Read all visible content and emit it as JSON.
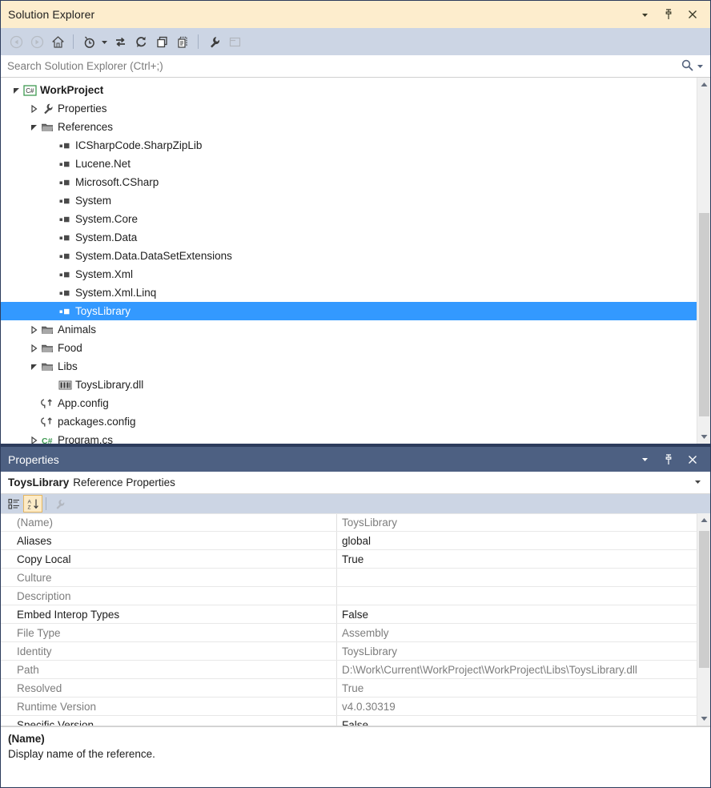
{
  "solution_explorer": {
    "title": "Solution Explorer",
    "window_buttons": [
      {
        "name": "dropdown",
        "glyph": "chevron-down-icon"
      },
      {
        "name": "pin",
        "glyph": "pin-icon"
      },
      {
        "name": "close",
        "glyph": "close-icon"
      }
    ],
    "toolbar": [
      {
        "name": "back-button",
        "icon": "back-arrow-icon",
        "enabled": false
      },
      {
        "name": "forward-button",
        "icon": "forward-arrow-icon",
        "enabled": false
      },
      {
        "name": "home-button",
        "icon": "home-icon",
        "enabled": true
      },
      {
        "name": "pending-changes-button",
        "icon": "clock-filter-icon",
        "enabled": true,
        "has_dropdown": true
      },
      {
        "name": "sync-with-active-document-button",
        "icon": "sync-arrows-icon",
        "enabled": true
      },
      {
        "name": "refresh-button",
        "icon": "refresh-icon",
        "enabled": true
      },
      {
        "name": "collapse-all-button",
        "icon": "collapse-all-icon",
        "enabled": true
      },
      {
        "name": "show-all-files-button",
        "icon": "show-all-files-icon",
        "enabled": true
      },
      {
        "name": "properties-button",
        "icon": "wrench-icon",
        "enabled": true
      },
      {
        "name": "preview-selected-items-button",
        "icon": "preview-window-icon",
        "enabled": false
      }
    ],
    "search": {
      "placeholder": "Search Solution Explorer (Ctrl+;)",
      "search_icon": "magnifier-icon",
      "dropdown_icon": "chevron-down-icon"
    },
    "tree": [
      {
        "label": "WorkProject",
        "indent": 0,
        "expander": "expanded",
        "icon": "csharp-project-icon",
        "bold": true,
        "selected": false
      },
      {
        "label": "Properties",
        "indent": 1,
        "expander": "collapsed",
        "icon": "wrench-icon",
        "bold": false,
        "selected": false
      },
      {
        "label": "References",
        "indent": 1,
        "expander": "expanded",
        "icon": "folder-icon",
        "bold": false,
        "selected": false
      },
      {
        "label": "ICSharpCode.SharpZipLib",
        "indent": 2,
        "expander": "none",
        "icon": "reference-icon",
        "bold": false,
        "selected": false
      },
      {
        "label": "Lucene.Net",
        "indent": 2,
        "expander": "none",
        "icon": "reference-icon",
        "bold": false,
        "selected": false
      },
      {
        "label": "Microsoft.CSharp",
        "indent": 2,
        "expander": "none",
        "icon": "reference-icon",
        "bold": false,
        "selected": false
      },
      {
        "label": "System",
        "indent": 2,
        "expander": "none",
        "icon": "reference-icon",
        "bold": false,
        "selected": false
      },
      {
        "label": "System.Core",
        "indent": 2,
        "expander": "none",
        "icon": "reference-icon",
        "bold": false,
        "selected": false
      },
      {
        "label": "System.Data",
        "indent": 2,
        "expander": "none",
        "icon": "reference-icon",
        "bold": false,
        "selected": false
      },
      {
        "label": "System.Data.DataSetExtensions",
        "indent": 2,
        "expander": "none",
        "icon": "reference-icon",
        "bold": false,
        "selected": false
      },
      {
        "label": "System.Xml",
        "indent": 2,
        "expander": "none",
        "icon": "reference-icon",
        "bold": false,
        "selected": false
      },
      {
        "label": "System.Xml.Linq",
        "indent": 2,
        "expander": "none",
        "icon": "reference-icon",
        "bold": false,
        "selected": false
      },
      {
        "label": "ToysLibrary",
        "indent": 2,
        "expander": "none",
        "icon": "reference-icon",
        "bold": false,
        "selected": true
      },
      {
        "label": "Animals",
        "indent": 1,
        "expander": "collapsed",
        "icon": "folder-icon",
        "bold": false,
        "selected": false
      },
      {
        "label": "Food",
        "indent": 1,
        "expander": "collapsed",
        "icon": "folder-icon",
        "bold": false,
        "selected": false
      },
      {
        "label": "Libs",
        "indent": 1,
        "expander": "expanded",
        "icon": "folder-icon",
        "bold": false,
        "selected": false
      },
      {
        "label": "ToysLibrary.dll",
        "indent": 2,
        "expander": "none",
        "icon": "dll-icon",
        "bold": false,
        "selected": false
      },
      {
        "label": "App.config",
        "indent": 1,
        "expander": "none",
        "icon": "config-icon",
        "bold": false,
        "selected": false
      },
      {
        "label": "packages.config",
        "indent": 1,
        "expander": "none",
        "icon": "config-icon",
        "bold": false,
        "selected": false
      },
      {
        "label": "Program.cs",
        "indent": 1,
        "expander": "collapsed",
        "icon": "csharp-file-icon",
        "bold": false,
        "selected": false
      }
    ],
    "scrollbar": {
      "up_arrow": "scroll-up-icon",
      "down_arrow": "scroll-down-icon",
      "thumb_top_pct": 36,
      "thumb_height_pct": 60
    }
  },
  "properties": {
    "title": "Properties",
    "window_buttons": [
      {
        "name": "dropdown",
        "glyph": "chevron-down-icon"
      },
      {
        "name": "pin",
        "glyph": "pin-icon"
      },
      {
        "name": "close",
        "glyph": "close-icon"
      }
    ],
    "object_name": "ToysLibrary",
    "object_kind": "Reference Properties",
    "object_dropdown_icon": "chevron-down-icon",
    "toolbar": [
      {
        "name": "categorized-button",
        "icon": "categorized-icon",
        "active": false,
        "enabled": true
      },
      {
        "name": "alphabetical-button",
        "icon": "alphabetical-sort-icon",
        "active": true,
        "enabled": true
      },
      {
        "name": "property-pages-button",
        "icon": "wrench-icon",
        "active": false,
        "enabled": false
      }
    ],
    "rows": [
      {
        "name": "(Name)",
        "value": "ToysLibrary",
        "readonly": true
      },
      {
        "name": "Aliases",
        "value": "global",
        "readonly": false
      },
      {
        "name": "Copy Local",
        "value": "True",
        "readonly": false
      },
      {
        "name": "Culture",
        "value": "",
        "readonly": true
      },
      {
        "name": "Description",
        "value": "",
        "readonly": true
      },
      {
        "name": "Embed Interop Types",
        "value": "False",
        "readonly": false
      },
      {
        "name": "File Type",
        "value": "Assembly",
        "readonly": true
      },
      {
        "name": "Identity",
        "value": "ToysLibrary",
        "readonly": true
      },
      {
        "name": "Path",
        "value": "D:\\Work\\Current\\WorkProject\\WorkProject\\Libs\\ToysLibrary.dll",
        "readonly": true
      },
      {
        "name": "Resolved",
        "value": "True",
        "readonly": true
      },
      {
        "name": "Runtime Version",
        "value": "v4.0.30319",
        "readonly": true
      },
      {
        "name": "Specific Version",
        "value": "False",
        "readonly": false
      }
    ],
    "scrollbar": {
      "up_arrow": "scroll-up-icon",
      "down_arrow": "scroll-down-icon",
      "thumb_top_pct": 2,
      "thumb_height_pct": 74
    },
    "description": {
      "title": "(Name)",
      "text": "Display name of the reference."
    }
  },
  "colors": {
    "titlebar_active": "#FDEDCD",
    "properties_titlebar": "#4D6082",
    "selection": "#3399FF",
    "toolbar": "#CCD5E4",
    "frame": "#2D3C5C"
  }
}
